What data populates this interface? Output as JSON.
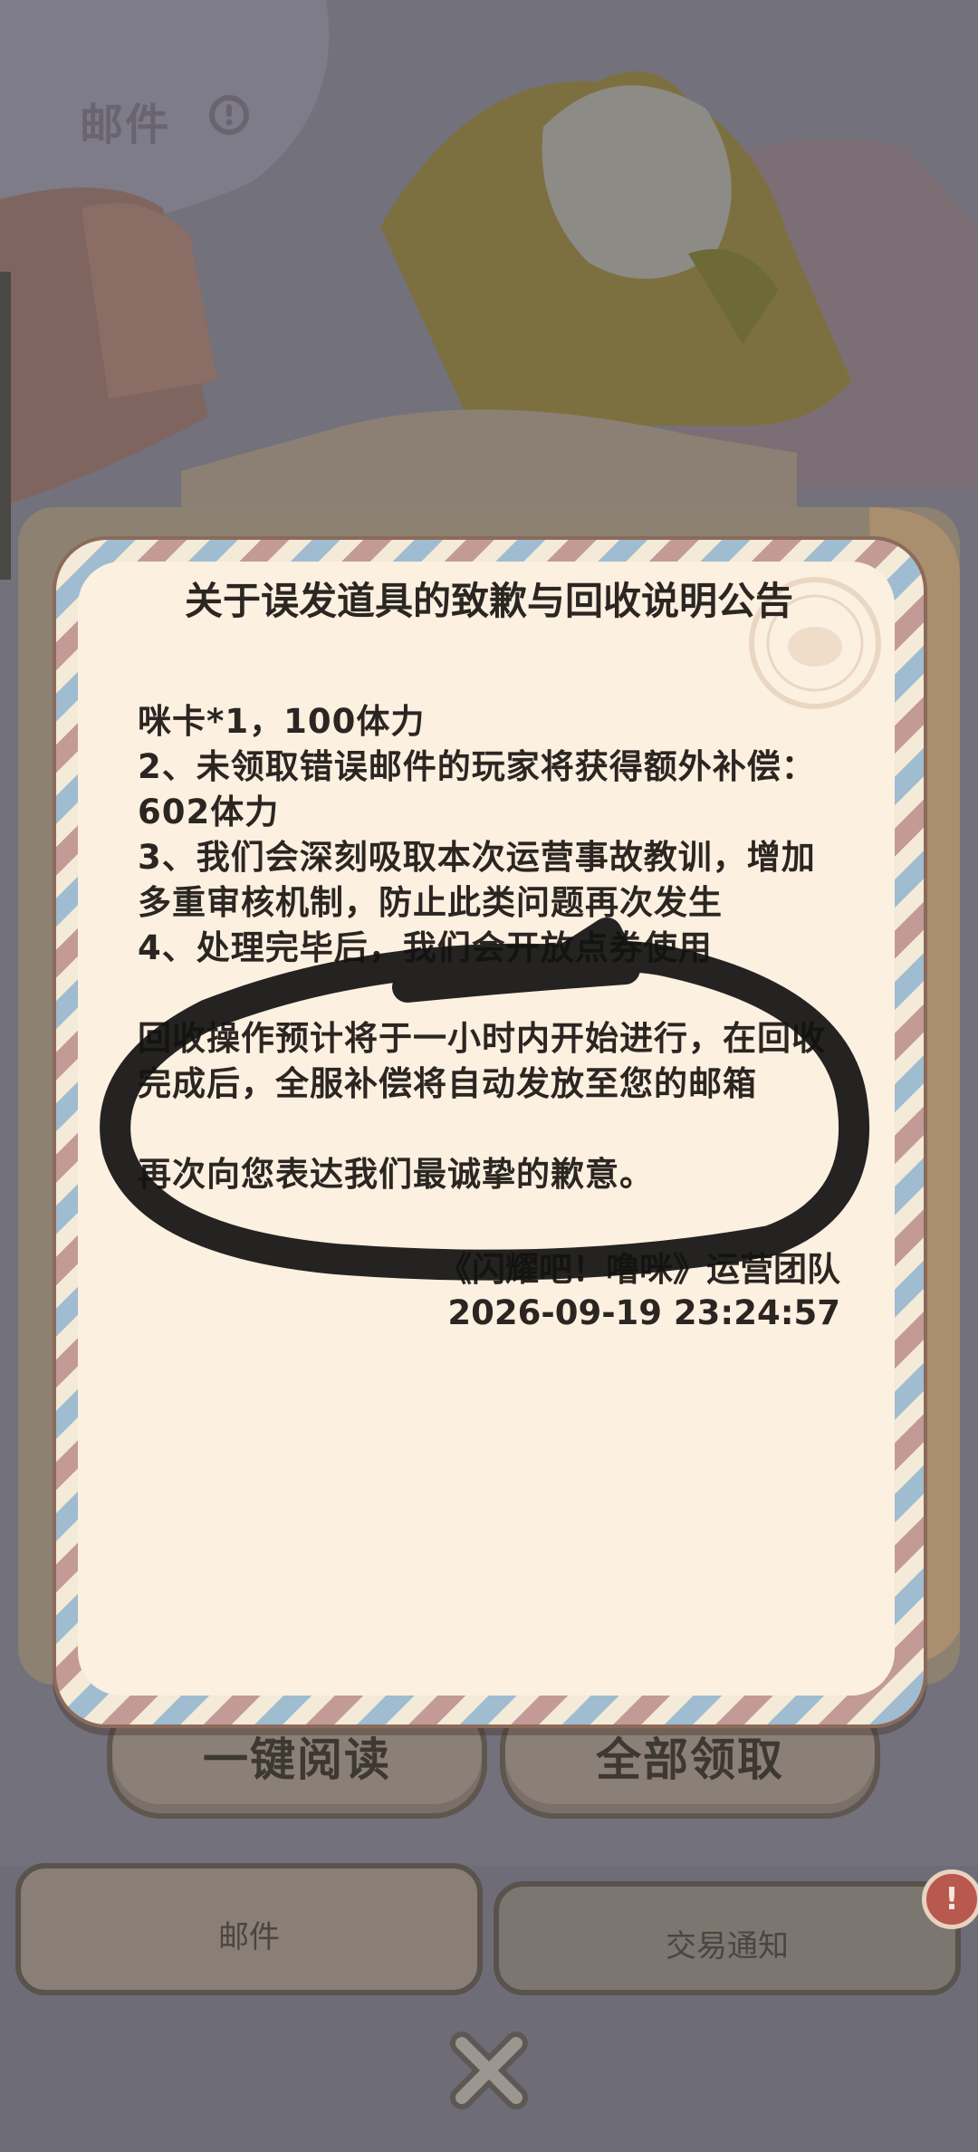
{
  "header": {
    "title": "邮件"
  },
  "notice": {
    "title": "关于误发道具的致歉与回收说明公告",
    "lines": [
      "咪卡*1，100体力",
      "2、未领取错误邮件的玩家将获得额外补偿：602体力",
      "3、我们会深刻吸取本次运营事故教训，增加多重审核机制，防止此类问题再次发生",
      "4、处理完毕后，我们会开放点券使用"
    ],
    "paragraph": "回收操作预计将于一小时内开始进行，在回收完成后，全服补偿将自动发放至您的邮箱",
    "closing": "再次向您表达我们最诚挚的歉意。",
    "team": "《闪耀吧！噜咪》运营团队",
    "timestamp": "2026-09-19 23:24:57"
  },
  "actions": {
    "read_all": "一键阅读",
    "claim_all": "全部领取"
  },
  "tabs": {
    "mail": "邮件",
    "trade": "交易通知",
    "trade_badge": "!"
  },
  "colors": {
    "paper": "#fcf0e1",
    "dim_overlay": "#74737f",
    "scribble": "#111111"
  },
  "icons": {
    "info": "info-icon",
    "close": "close-icon",
    "stamp": "stamp-icon"
  }
}
